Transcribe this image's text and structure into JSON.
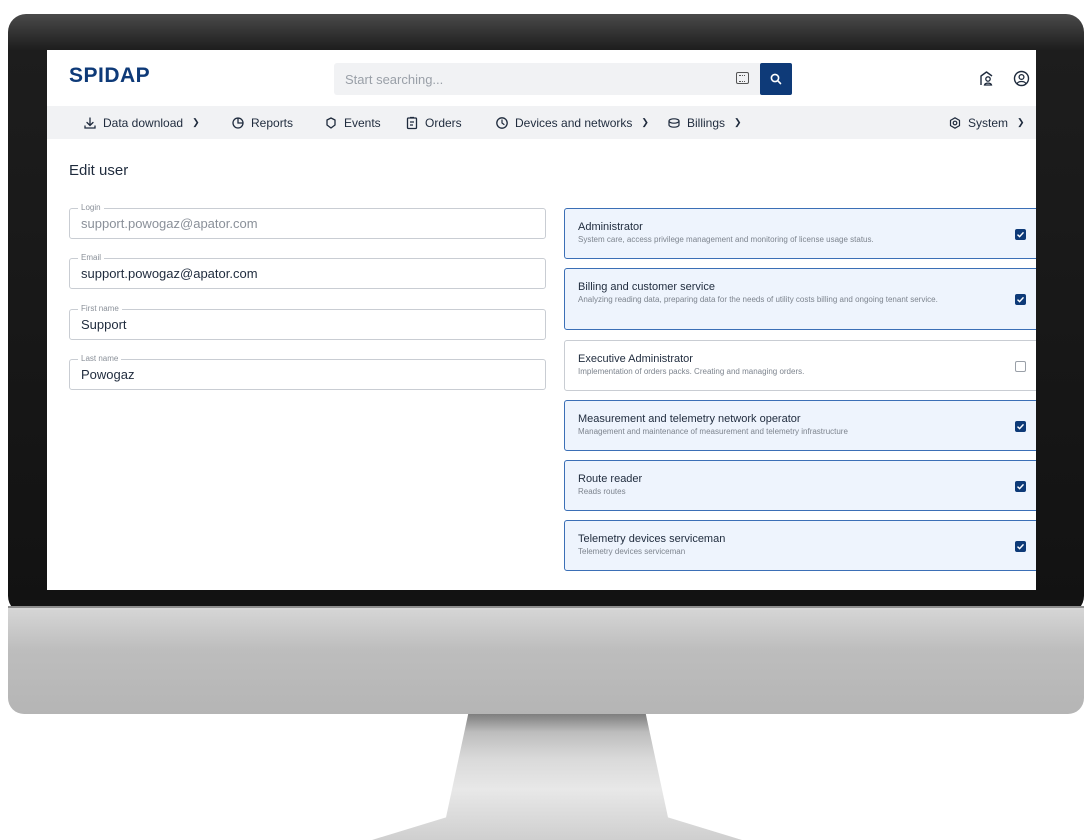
{
  "header": {
    "logo": "SPIDAP",
    "search_placeholder": "Start searching..."
  },
  "nav": {
    "items": [
      {
        "label": "Data download",
        "icon": "download-icon",
        "has_dropdown": true
      },
      {
        "label": "Reports",
        "icon": "reports-icon",
        "has_dropdown": false
      },
      {
        "label": "Events",
        "icon": "events-icon",
        "has_dropdown": false
      },
      {
        "label": "Orders",
        "icon": "orders-icon",
        "has_dropdown": false
      },
      {
        "label": "Devices and networks",
        "icon": "devices-icon",
        "has_dropdown": true
      },
      {
        "label": "Billings",
        "icon": "billings-icon",
        "has_dropdown": true
      },
      {
        "label": "System",
        "icon": "system-icon",
        "has_dropdown": true
      }
    ]
  },
  "page": {
    "title": "Edit user"
  },
  "form": {
    "login": {
      "label": "Login",
      "value": "support.powogaz@apator.com",
      "disabled": true
    },
    "email": {
      "label": "Email",
      "value": "support.powogaz@apator.com"
    },
    "first_name": {
      "label": "First name",
      "value": "Support"
    },
    "last_name": {
      "label": "Last name",
      "value": "Powogaz"
    }
  },
  "roles": [
    {
      "title": "Administrator",
      "description": "System care, access privilege management and monitoring of license usage status.",
      "checked": true
    },
    {
      "title": "Billing and customer service",
      "description": "Analyzing reading data, preparing data for the needs of utility costs billing and ongoing tenant service.",
      "checked": true
    },
    {
      "title": "Executive Administrator",
      "description": "Implementation of orders packs. Creating and managing orders.",
      "checked": false
    },
    {
      "title": "Measurement and telemetry network operator",
      "description": "Management and maintenance of measurement and telemetry infrastructure",
      "checked": true
    },
    {
      "title": "Route reader",
      "description": "Reads routes",
      "checked": true
    },
    {
      "title": "Telemetry devices serviceman",
      "description": "Telemetry devices serviceman",
      "checked": true
    }
  ],
  "colors": {
    "brand": "#0e3a78",
    "selected_card_bg": "#eef4fd",
    "selected_card_border": "#3b6fb6"
  }
}
